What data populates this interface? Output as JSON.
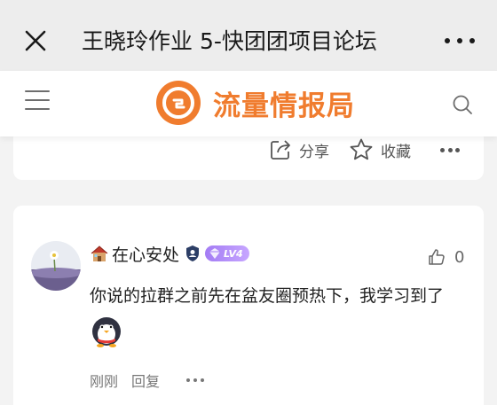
{
  "titlebar": {
    "title": "王晓玲作业 5-快团团项目论坛",
    "close_icon": "close-icon",
    "more_icon": "more-horizontal-icon"
  },
  "site_header": {
    "logo_text": "流量情报局",
    "brand_color": "#f07c2e",
    "menu_icon": "menu-icon",
    "search_icon": "search-icon"
  },
  "post_actions": {
    "share_label": "分享",
    "favorite_label": "收藏"
  },
  "comment": {
    "username": "在心安处",
    "level_label": "LV4",
    "text": "你说的拉群之前先在盆友圈预热下，我学习到了",
    "like_count": "0",
    "time": "刚刚",
    "reply_label": "回复"
  }
}
